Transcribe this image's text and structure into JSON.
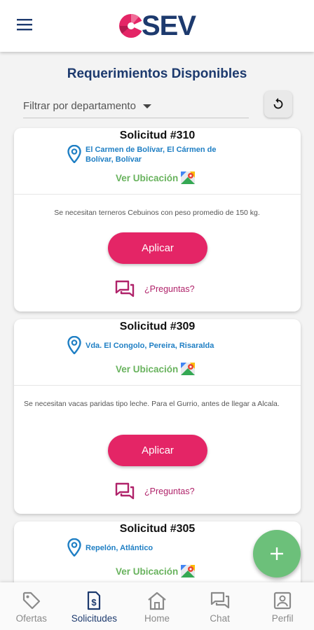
{
  "header": {
    "logo_text": "SEV",
    "brand_colors": {
      "primary": "#1d3a6e",
      "accent": "#e42566"
    }
  },
  "page": {
    "title": "Requerimientos Disponibles",
    "filter_label": "Filtrar por departamento"
  },
  "cards": [
    {
      "title": "Solicitud #310",
      "location": "El Carmen de Bolívar, El Cármen de Bolívar, Bolívar",
      "see_location": "Ver Ubicación",
      "description": "Se necesitan terneros Cebuinos con peso promedio de 150 kg.",
      "apply_label": "Aplicar",
      "questions_label": "¿Preguntas?"
    },
    {
      "title": "Solicitud #309",
      "location": "Vda. El Congolo, Pereira, Risaralda",
      "see_location": "Ver Ubicación",
      "description": "Se necesitan vacas paridas tipo leche. Para el Gurrio, antes de llegar a Alcala.",
      "apply_label": "Aplicar",
      "questions_label": "¿Preguntas?"
    },
    {
      "title": "Solicitud #305",
      "location": "Repelón, Atlántico",
      "see_location": "Ver Ubicación"
    }
  ],
  "nav": {
    "items": [
      {
        "label": "Ofertas",
        "icon": "tag-icon"
      },
      {
        "label": "Solicitudes",
        "icon": "document-dollar-icon",
        "active": true
      },
      {
        "label": "Home",
        "icon": "home-icon"
      },
      {
        "label": "Chat",
        "icon": "chat-icon"
      },
      {
        "label": "Perfil",
        "icon": "profile-icon"
      }
    ]
  },
  "fab": {
    "icon": "plus-icon",
    "color": "#6cc07a"
  }
}
